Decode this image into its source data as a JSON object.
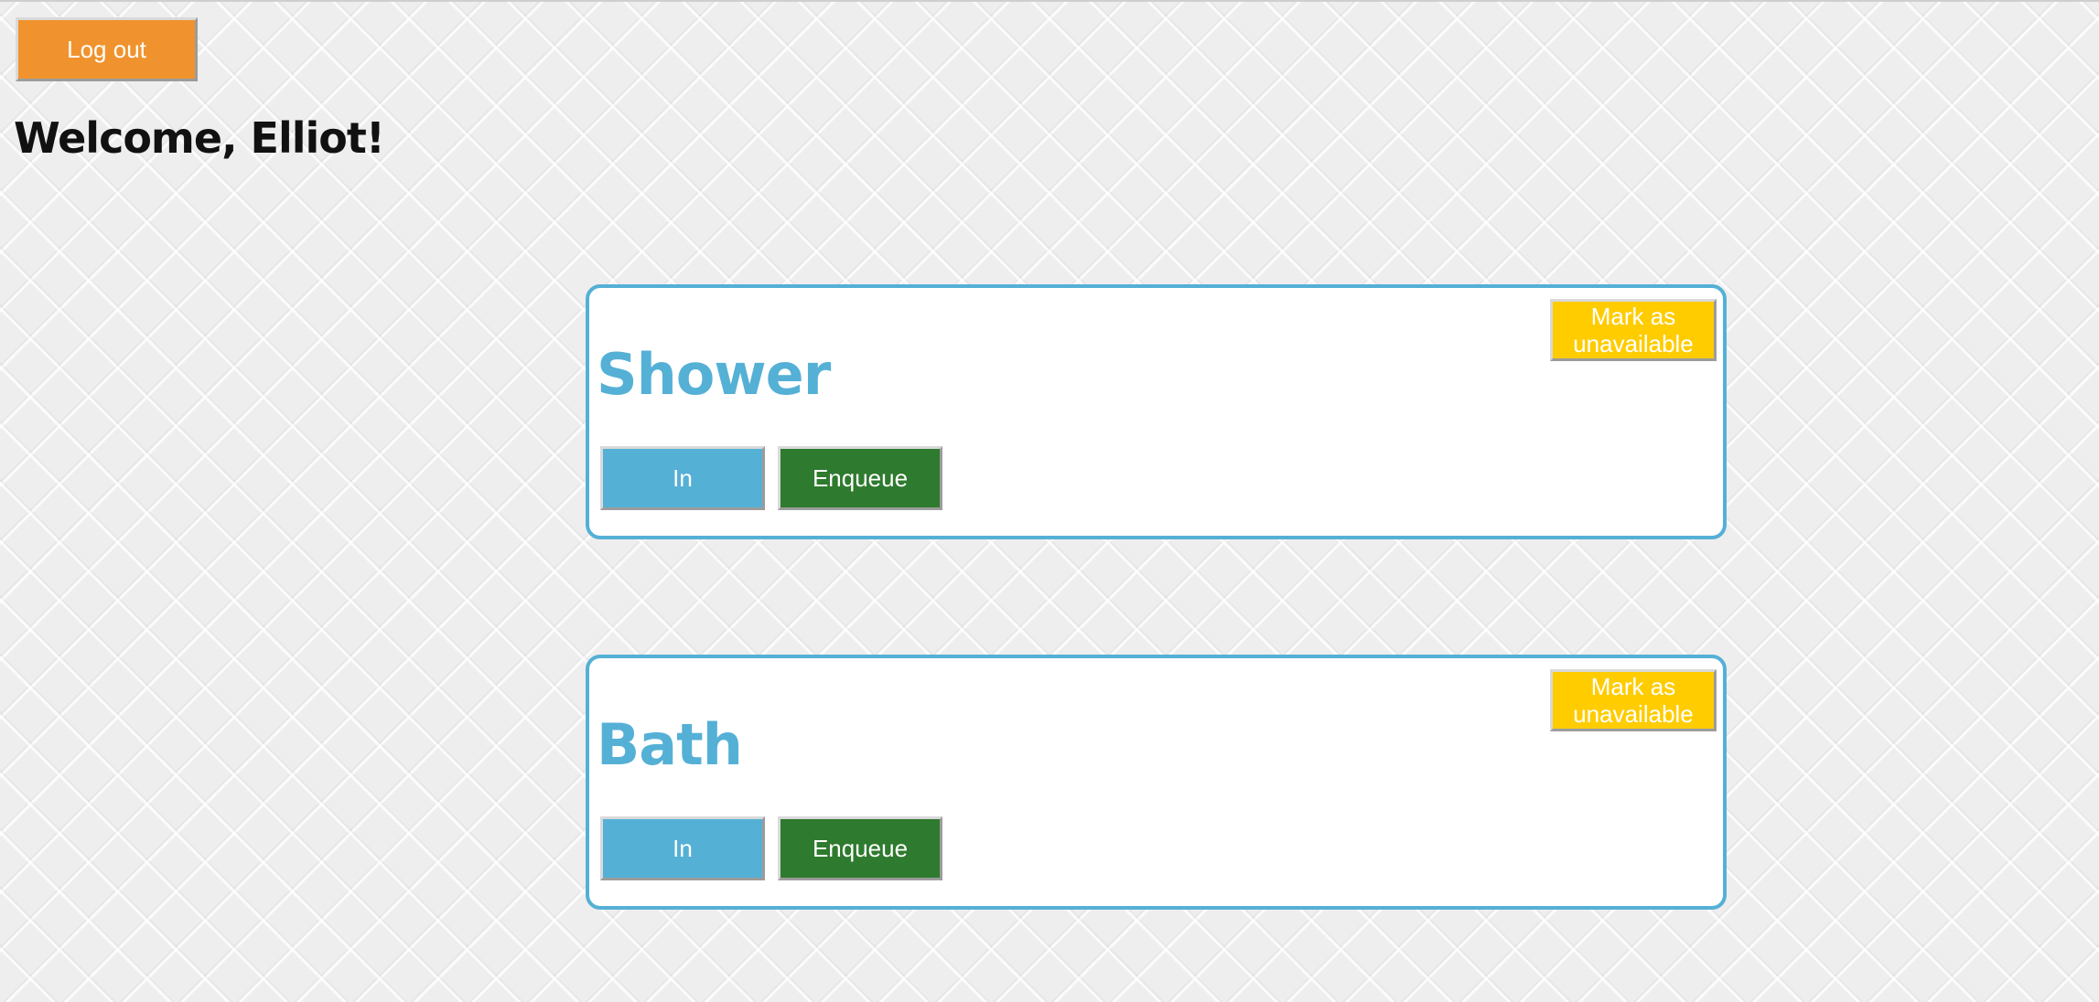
{
  "header": {
    "logout_label": "Log out",
    "welcome_text": "Welcome, Elliot!"
  },
  "rooms": [
    {
      "name": "Shower",
      "in_label": "In",
      "enqueue_label": "Enqueue",
      "mark_unavailable_label": "Mark as unavailable"
    },
    {
      "name": "Bath",
      "in_label": "In",
      "enqueue_label": "Enqueue",
      "mark_unavailable_label": "Mark as unavailable"
    }
  ],
  "colors": {
    "logout": "#f0932e",
    "accent": "#55b0d6",
    "enqueue": "#2e7a2e",
    "unavailable": "#ffcc00"
  }
}
